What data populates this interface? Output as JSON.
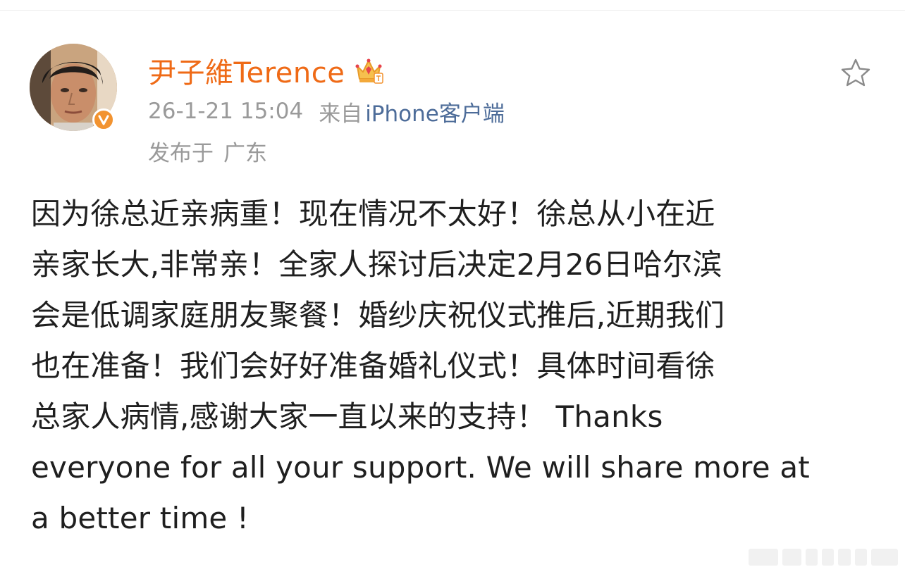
{
  "post": {
    "author": {
      "name": "尹子維Terence",
      "badge_icon": "vip-crown-icon",
      "verified_icon": "verified-v-icon"
    },
    "timestamp": "26-1-21 15:04",
    "source_prefix": "来自",
    "source_name": "iPhone客户端",
    "location_prefix": "发布于",
    "location": "广东",
    "body": "因为徐总近亲病重！现在情况不太好！徐总从小在近\n亲家长大,非常亲！全家人探讨后决定2月26日哈尔滨\n会是低调家庭朋友聚餐！婚纱庆祝仪式推后,近期我们\n也在准备！我们会好好准备婚礼仪式！具体时间看徐\n总家人病情,感谢大家一直以来的支持！ Thanks\neveryone for all your support.  We will share more at\na better time !",
    "actions": {
      "favorite_icon": "star-outline-icon"
    }
  },
  "colors": {
    "username": "#ef6a16",
    "meta": "#9a9a9a",
    "link": "#4d6c99",
    "body_text": "#1f1f1f",
    "verified_badge": "#f29330"
  }
}
